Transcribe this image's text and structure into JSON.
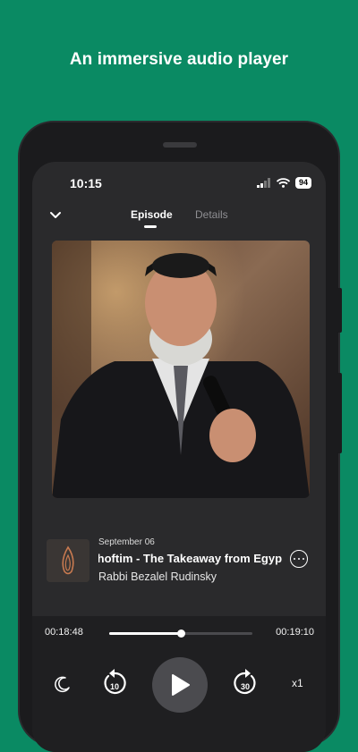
{
  "headline": "An immersive audio player",
  "status_bar": {
    "time": "10:15",
    "battery": "94"
  },
  "tabs": [
    {
      "label": "Episode",
      "active": true
    },
    {
      "label": "Details",
      "active": false
    }
  ],
  "episode": {
    "date": "September 06",
    "title": "Shoftim - The Takeaway from Egypt",
    "author": "Rabbi Bezalel Rudinsky"
  },
  "player": {
    "current_time": "00:18:48",
    "total_time": "00:19:10",
    "progress": 0.5,
    "rewind_seconds": "10",
    "forward_seconds": "30",
    "speed": "x1"
  },
  "colors": {
    "background": "#0a8a63",
    "player_bg": "#1f1f21",
    "accent": "#ffffff"
  }
}
